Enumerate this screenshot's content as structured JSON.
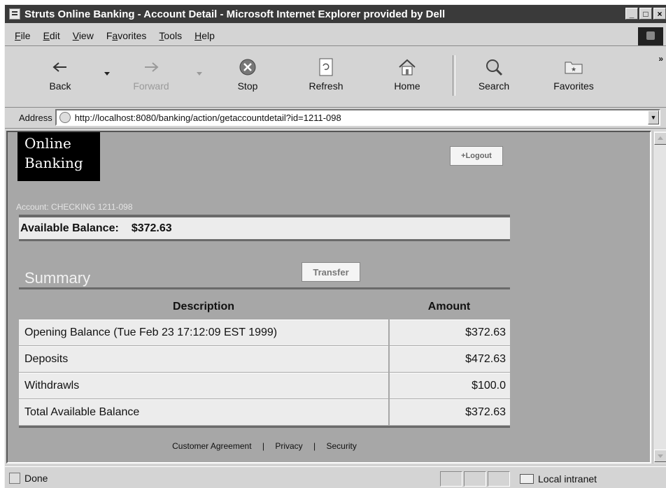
{
  "window": {
    "title": "Struts Online Banking - Account Detail - Microsoft Internet Explorer provided by Dell"
  },
  "menu": [
    {
      "label": "File",
      "key": "F",
      "rest": "ile"
    },
    {
      "label": "Edit",
      "key": "E",
      "rest": "dit"
    },
    {
      "label": "View",
      "key": "V",
      "rest": "iew"
    },
    {
      "label": "Favorites",
      "key": "a",
      "pre": "F",
      "rest": "vorites"
    },
    {
      "label": "Tools",
      "key": "T",
      "rest": "ools"
    },
    {
      "label": "Help",
      "key": "H",
      "rest": "elp"
    }
  ],
  "toolbar": {
    "back": "Back",
    "forward": "Forward",
    "stop": "Stop",
    "refresh": "Refresh",
    "home": "Home",
    "search": "Search",
    "favorites": "Favorites",
    "more": "»"
  },
  "address": {
    "label": "Address",
    "url": "http://localhost:8080/banking/action/getaccountdetail?id=1211-098"
  },
  "page": {
    "logo_line1": "Online",
    "logo_line2": "Banking",
    "logout": "+Logout",
    "account_label": "Account: CHECKING 1211-098",
    "available_balance_label": "Available Balance:",
    "available_balance_value": "$372.63",
    "summary_title": "Summary",
    "transfer_button": "Transfer",
    "table": {
      "headers": {
        "description": "Description",
        "amount": "Amount"
      },
      "rows": [
        {
          "description": "Opening Balance (Tue Feb 23 17:12:09 EST 1999)",
          "amount": "$372.63"
        },
        {
          "description": "Deposits",
          "amount": "$472.63"
        },
        {
          "description": "Withdrawls",
          "amount": "$100.0"
        },
        {
          "description": "Total Available Balance",
          "amount": "$372.63"
        }
      ]
    },
    "footer": {
      "agreement": "Customer Agreement",
      "sep": "|",
      "privacy": "Privacy",
      "security": "Security"
    }
  },
  "status": {
    "text": "Done",
    "zone": "Local intranet"
  }
}
